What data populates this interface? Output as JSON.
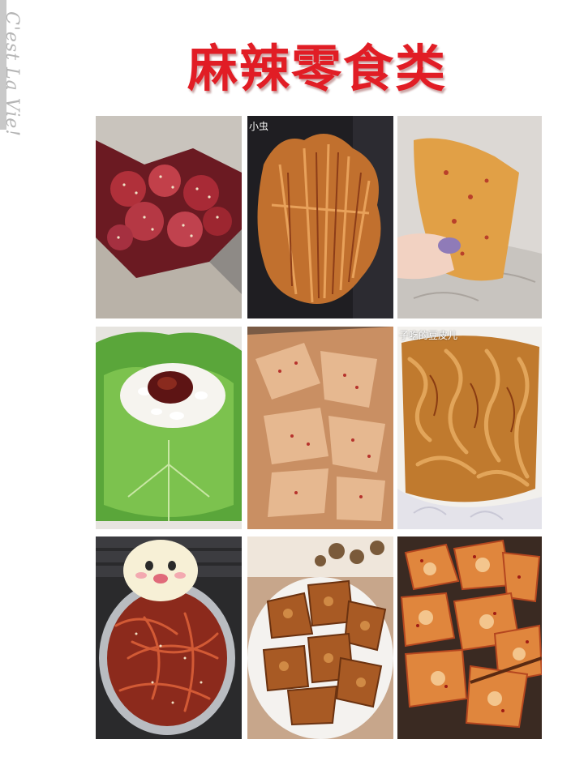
{
  "header": {
    "side_text": "C'est La Vie!",
    "title": "麻辣零食类"
  },
  "photos": [
    {
      "name": "spicy-beef-cubes-photo"
    },
    {
      "name": "spicy-tofu-skin-bundle-photo",
      "overlay_text": "小虫"
    },
    {
      "name": "spicy-gluten-strip-photo"
    },
    {
      "name": "lettuce-rice-wrap-photo"
    },
    {
      "name": "spicy-tofu-skin-plate-photo"
    },
    {
      "name": "spicy-tofu-skin-noodles-photo",
      "overlay_text": "子吃的豆皮儿"
    },
    {
      "name": "spicy-shredded-squid-photo"
    },
    {
      "name": "braised-tofu-pieces-photo"
    },
    {
      "name": "spicy-fried-tofu-photo"
    }
  ]
}
